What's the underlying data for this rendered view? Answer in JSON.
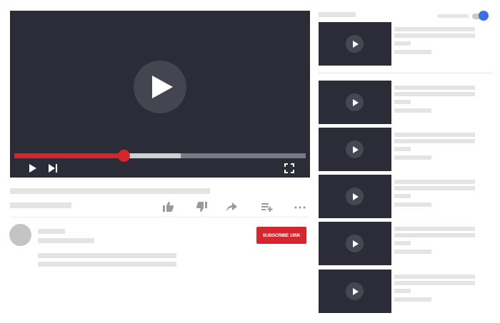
{
  "player": {
    "progress_played": 0.375,
    "progress_buffered": 0.57
  },
  "channel": {
    "subscribe_label": "SUBSCRIBE 195K"
  },
  "sidebar": {
    "autoplay_on": true,
    "recommended_count": 6
  },
  "icons": {
    "big_play": "play-icon",
    "controls": [
      "play-icon",
      "skip-next-icon",
      "fullscreen-icon"
    ],
    "actions": [
      "like-icon",
      "dislike-icon",
      "share-icon",
      "add-to-playlist-icon",
      "more-icon"
    ]
  },
  "colors": {
    "player_bg": "#2c2c39",
    "accent_red": "#d5262e",
    "toggle_blue": "#3b6ee6",
    "placeholder": "#e4e4e4"
  }
}
